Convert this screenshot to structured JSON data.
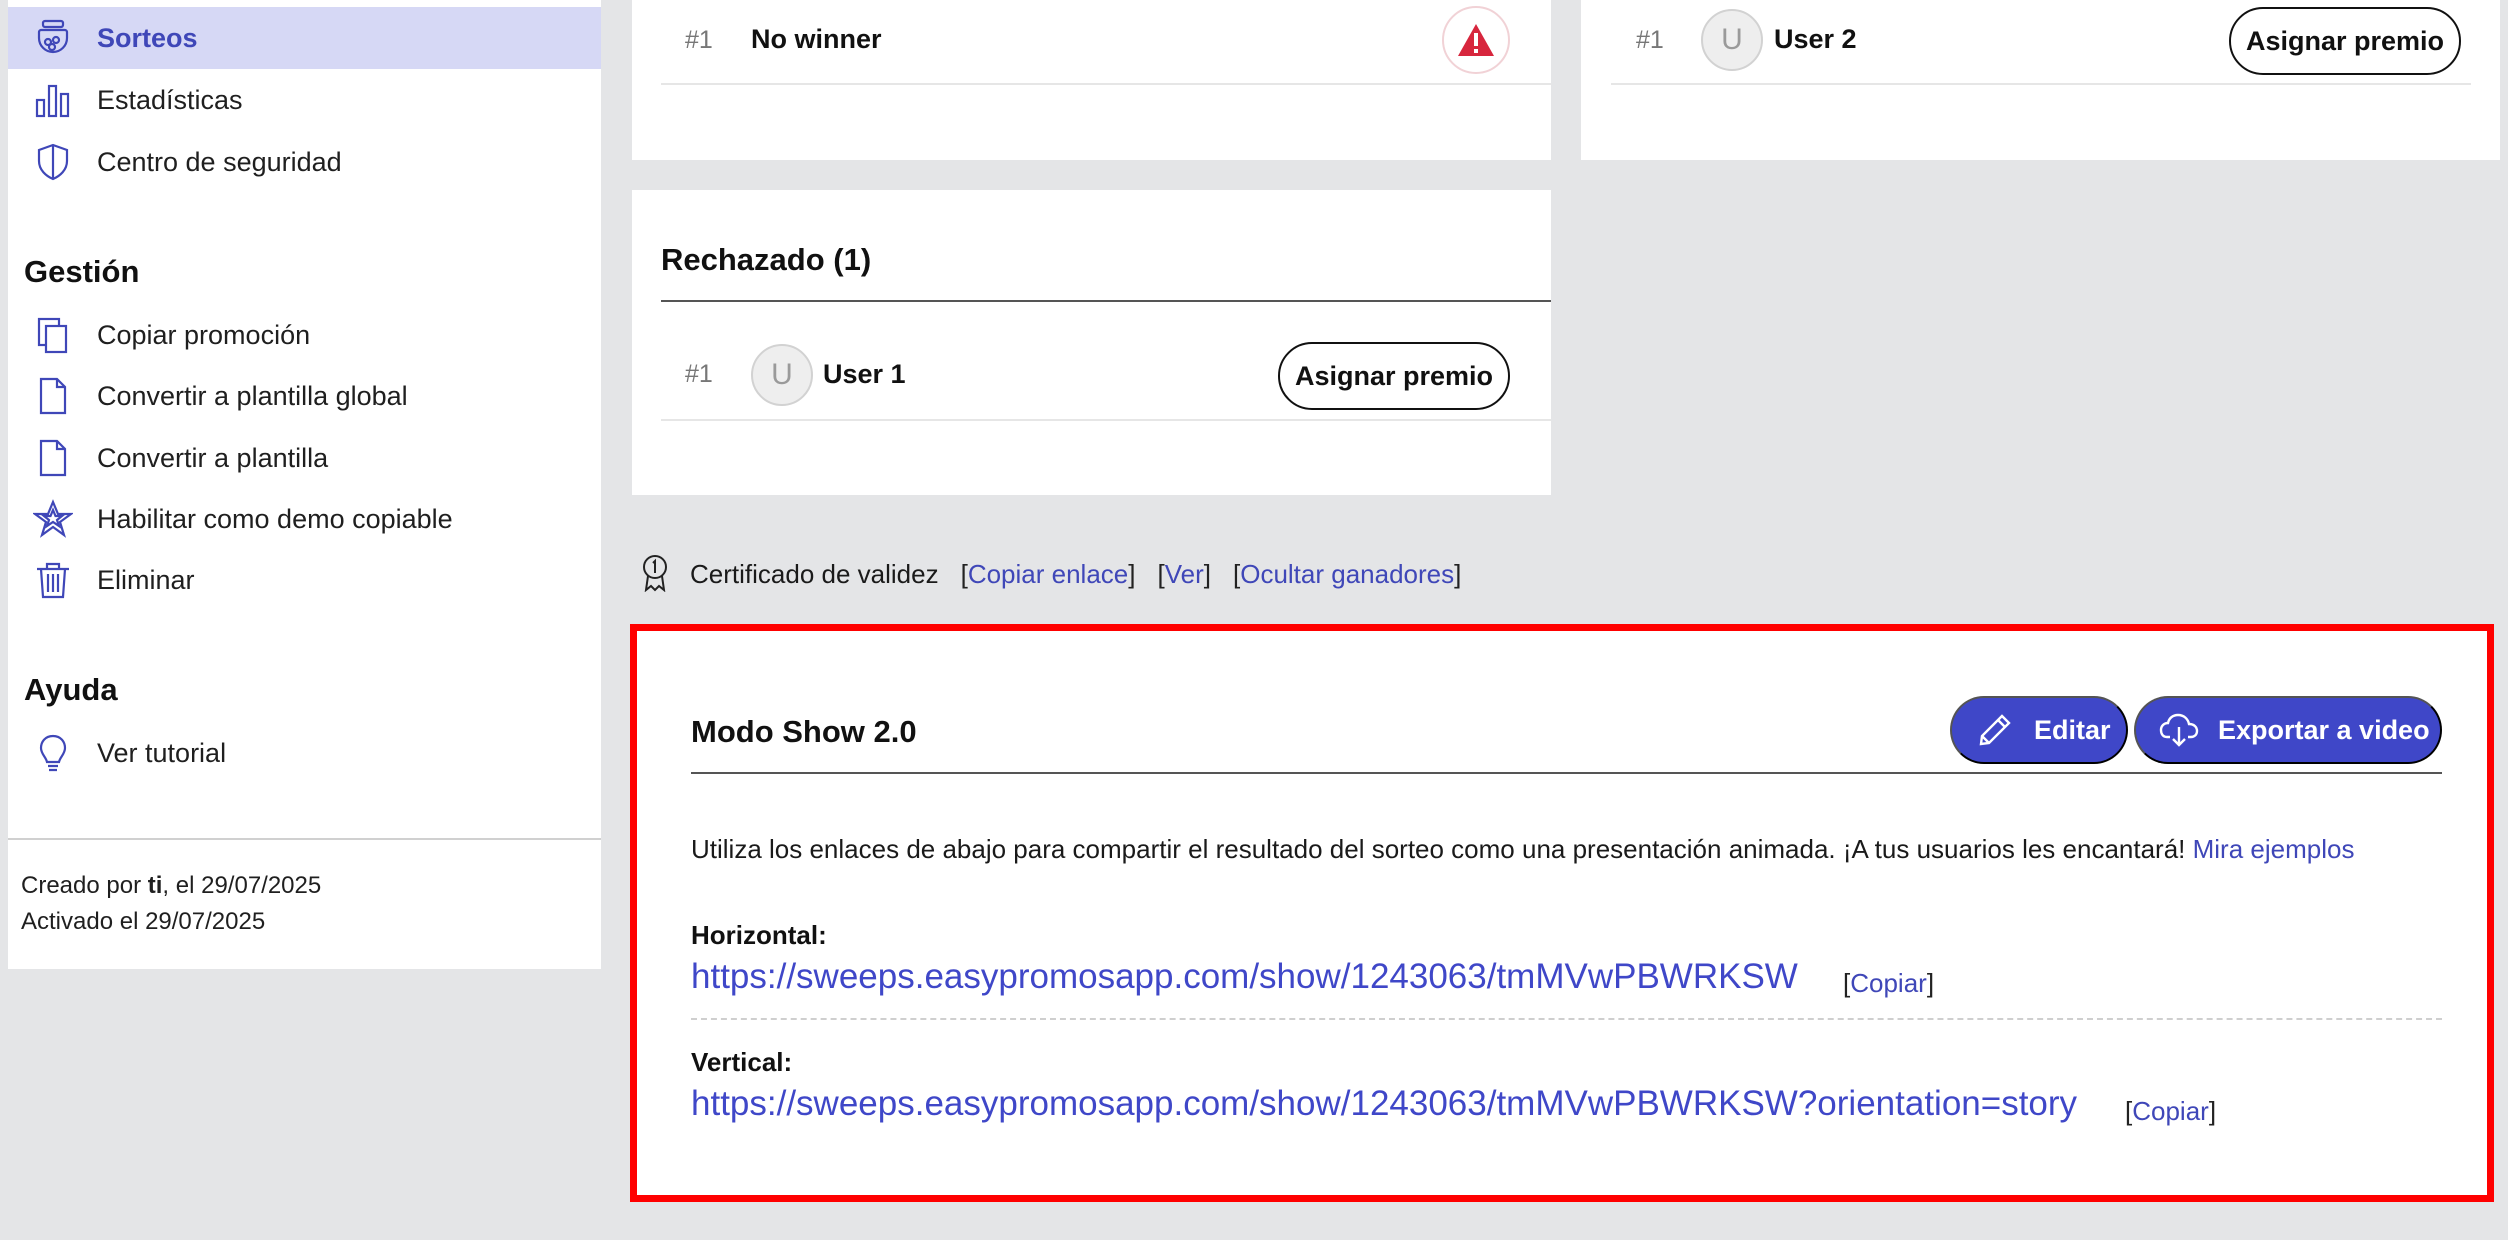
{
  "sidebar": {
    "nav": [
      {
        "label": "Sorteos",
        "icon": "prize-jar-icon",
        "active": true
      },
      {
        "label": "Estadísticas",
        "icon": "bar-chart-icon"
      },
      {
        "label": "Centro de seguridad",
        "icon": "shield-icon"
      }
    ],
    "gestion_title": "Gestión",
    "gestion": [
      {
        "label": "Copiar promoción",
        "icon": "copy-icon"
      },
      {
        "label": "Convertir a plantilla global",
        "icon": "document-icon"
      },
      {
        "label": "Convertir a plantilla",
        "icon": "document-icon"
      },
      {
        "label": "Habilitar como demo copiable",
        "icon": "star-icon"
      },
      {
        "label": "Eliminar",
        "icon": "trash-icon"
      }
    ],
    "ayuda_title": "Ayuda",
    "ayuda": [
      {
        "label": "Ver tutorial",
        "icon": "lightbulb-icon"
      }
    ],
    "created_prefix": "Creado por ",
    "created_by": "ti",
    "created_suffix": ", el 29/07/2025",
    "activated": "Activado el 29/07/2025"
  },
  "card_top_left": {
    "num": "#1",
    "name": "No winner",
    "icon": "warning-icon"
  },
  "card_top_right": {
    "num": "#1",
    "avatar": "U",
    "name": "User 2",
    "button": "Asignar premio"
  },
  "card_rejected": {
    "title": "Rechazado (1)",
    "num": "#1",
    "avatar": "U",
    "name": "User 1",
    "button": "Asignar premio"
  },
  "certificate": {
    "icon": "award-ribbon-icon",
    "label": "Certificado de validez",
    "copy_link": "Copiar enlace",
    "view": "Ver",
    "hide": "Ocultar ganadores"
  },
  "show": {
    "title": "Modo Show 2.0",
    "edit_label": "Editar",
    "export_label": "Exportar a video",
    "description": "Utiliza los enlaces de abajo para compartir el resultado del sorteo como una presentación animada. ¡A tus usuarios les encantará!",
    "examples_link": "Mira ejemplos",
    "horizontal_label": "Horizontal:",
    "horizontal_url": "https://sweeps.easypromosapp.com/show/1243063/tmMVwPBWRKSW",
    "vertical_label": "Vertical:",
    "vertical_url": "https://sweeps.easypromosapp.com/show/1243063/tmMVwPBWRKSW?orientation=story",
    "copy_label": "Copiar"
  },
  "colors": {
    "accent": "#3f47c8",
    "active_bg": "#d6d8f5",
    "highlight": "#ff0000",
    "warning": "#d7263d"
  }
}
